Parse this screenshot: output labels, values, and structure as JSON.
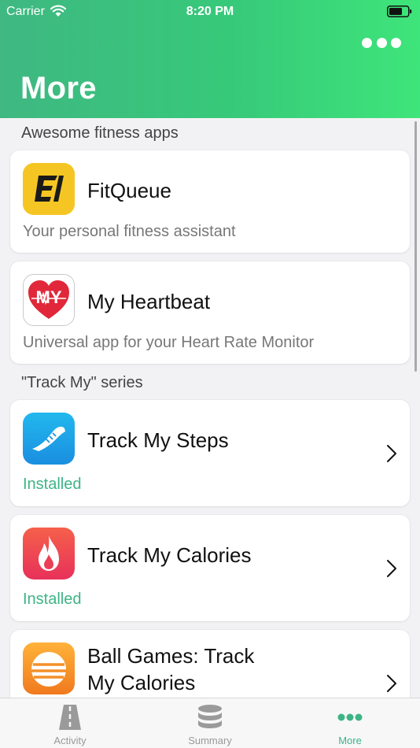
{
  "status_bar": {
    "carrier": "Carrier",
    "time": "8:20 PM"
  },
  "header": {
    "title": "More",
    "more_icon": "ellipsis-icon"
  },
  "sections": [
    {
      "title": "Awesome fitness apps",
      "items": [
        {
          "name": "FitQueue",
          "subtitle": "Your personal fitness assistant",
          "icon": "fitqueue-logo"
        },
        {
          "name": "My Heartbeat",
          "subtitle": "Universal app for your Heart Rate Monitor",
          "icon": "heartbeat-logo"
        }
      ]
    },
    {
      "title": "\"Track My\" series",
      "items": [
        {
          "name": "Track My Steps",
          "status": "Installed",
          "icon": "sneaker-logo"
        },
        {
          "name": "Track My Calories",
          "status": "Installed",
          "icon": "flame-logo"
        },
        {
          "name_line1": "Ball Games: Track",
          "name_line2": "My Calories",
          "icon": "ball-logo"
        }
      ]
    }
  ],
  "tabbar": {
    "tabs": [
      {
        "label": "Activity",
        "icon": "road-icon",
        "active": false
      },
      {
        "label": "Summary",
        "icon": "database-icon",
        "active": false
      },
      {
        "label": "More",
        "icon": "ellipsis-icon",
        "active": true
      }
    ]
  },
  "colors": {
    "accent": "#3db486",
    "header_start": "#3fb882",
    "header_end": "#3ee57a",
    "inactive_tab": "#999999"
  }
}
